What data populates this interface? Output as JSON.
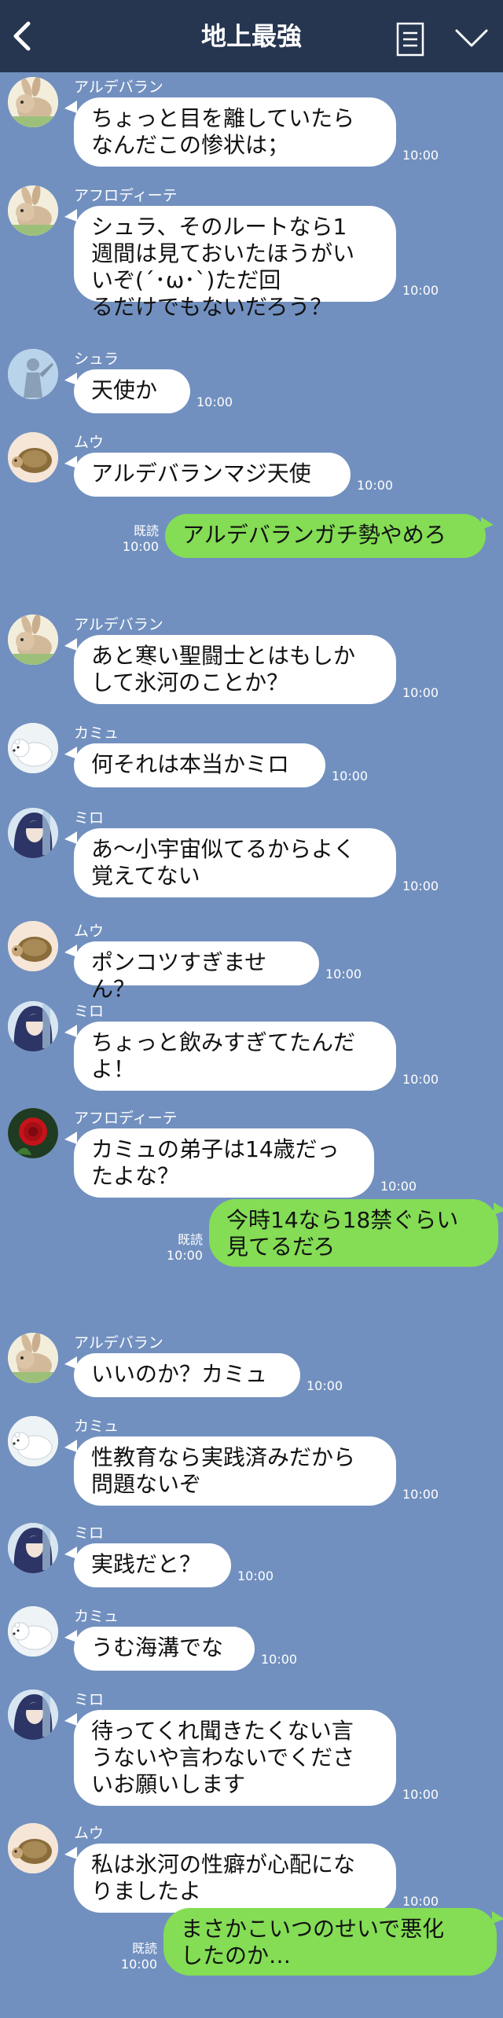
{
  "header": {
    "title": "地上最強"
  },
  "colors": {
    "header_bg": "#263650",
    "chat_bg": "#7190bf",
    "my_bubble": "#84dd55",
    "their_bubble": "#ffffff"
  },
  "messages": [
    {
      "sender": "アルデバラン",
      "avatar": "rabbit",
      "text": "ちょっと目を離していたら\nなんだこの惨状は；",
      "time": "10:00"
    },
    {
      "sender": "アフロディーテ",
      "avatar": "rabbit",
      "text": "シュラ、そのルートなら1\n週間は見ておいたほうがい\nいぞ(´･ω･`)ただ回\nるだけでもないだろう？",
      "time": "10:00"
    },
    {
      "sender": "シュラ",
      "avatar": "statue",
      "text": "天使か",
      "time": "10:00"
    },
    {
      "sender": "ムウ",
      "avatar": "turtle",
      "text": "アルデバランマジ天使",
      "time": "10:00"
    },
    {
      "me": true,
      "read": "既読",
      "text": "アルデバランガチ勢やめろ",
      "time": "10:00"
    },
    {
      "sender": "アルデバラン",
      "avatar": "rabbit",
      "text": "あと寒い聖闘士とはもしか\nして氷河のことか？",
      "time": "10:00"
    },
    {
      "sender": "カミュ",
      "avatar": "bear",
      "text": "何それは本当かミロ",
      "time": "10:00"
    },
    {
      "sender": "ミロ",
      "avatar": "girl",
      "text": "あ〜小宇宙似てるからよく\n覚えてない",
      "time": "10:00"
    },
    {
      "sender": "ムウ",
      "avatar": "turtle",
      "text": "ポンコツすぎません？",
      "time": "10:00"
    },
    {
      "sender": "ミロ",
      "avatar": "girl",
      "text": "ちょっと飲みすぎてたんだ\nよ！",
      "time": "10:00"
    },
    {
      "sender": "アフロディーテ",
      "avatar": "rose",
      "text": "カミュの弟子は14歳だっ\nたよな？",
      "time": "10:00"
    },
    {
      "me": true,
      "read": "既読",
      "text": "今時14なら18禁ぐらい\n見てるだろ",
      "time": "10:00"
    },
    {
      "sender": "アルデバラン",
      "avatar": "rabbit",
      "text": "いいのか？カミュ",
      "time": "10:00"
    },
    {
      "sender": "カミュ",
      "avatar": "bear",
      "text": "性教育なら実践済みだから\n問題ないぞ",
      "time": "10:00"
    },
    {
      "sender": "ミロ",
      "avatar": "girl",
      "text": "実践だと？",
      "time": "10:00"
    },
    {
      "sender": "カミュ",
      "avatar": "bear",
      "text": "うむ海溝でな",
      "time": "10:00"
    },
    {
      "sender": "ミロ",
      "avatar": "girl",
      "text": "待ってくれ聞きたくない言\nうないや言わないでくださ\nいお願いします",
      "time": "10:00"
    },
    {
      "sender": "ムウ",
      "avatar": "turtle",
      "text": "私は氷河の性癖が心配にな\nりましたよ",
      "time": "10:00"
    },
    {
      "me": true,
      "read": "既読",
      "text": "まさかこいつのせいで悪化\nしたのか…",
      "time": "10:00"
    }
  ]
}
